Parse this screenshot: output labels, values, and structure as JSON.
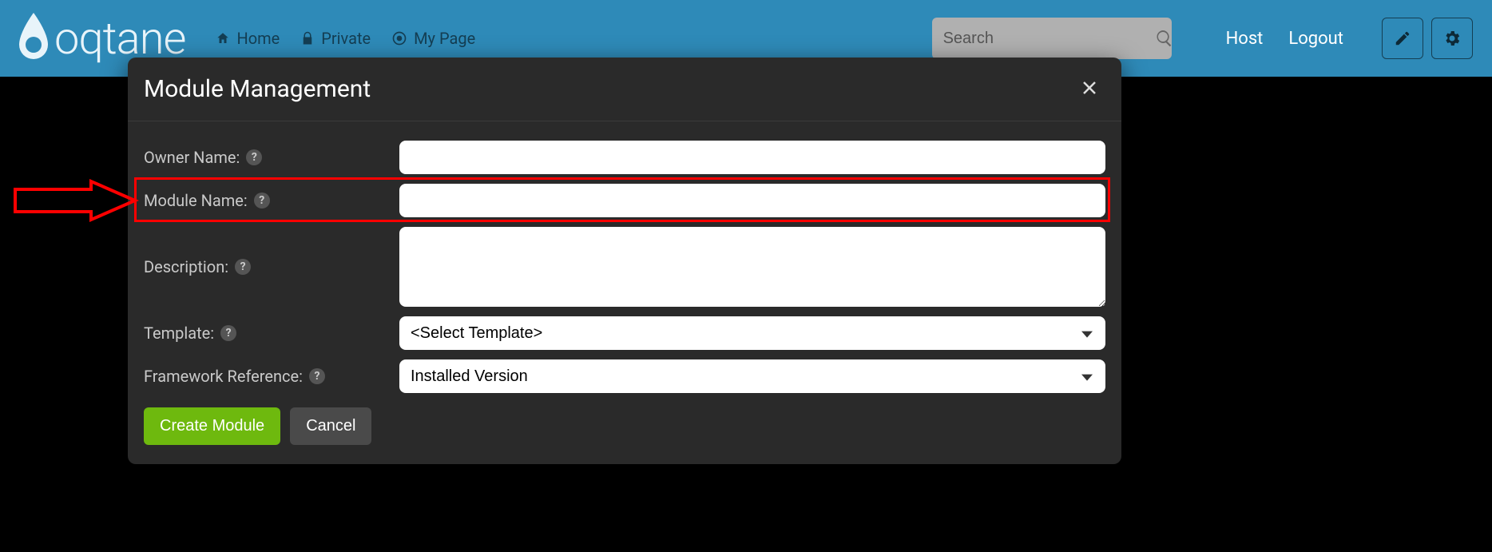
{
  "brand": {
    "name": "oqtane"
  },
  "nav": {
    "home": "Home",
    "private": "Private",
    "mypage": "My Page"
  },
  "search": {
    "placeholder": "Search"
  },
  "account": {
    "host": "Host",
    "logout": "Logout"
  },
  "modal": {
    "title": "Module Management",
    "owner_label": "Owner Name:",
    "module_label": "Module Name:",
    "description_label": "Description:",
    "template_label": "Template:",
    "template_option": "<Select Template>",
    "framework_label": "Framework Reference:",
    "framework_option": "Installed Version",
    "create_label": "Create Module",
    "cancel_label": "Cancel",
    "owner_value": "",
    "module_value": "",
    "description_value": ""
  }
}
